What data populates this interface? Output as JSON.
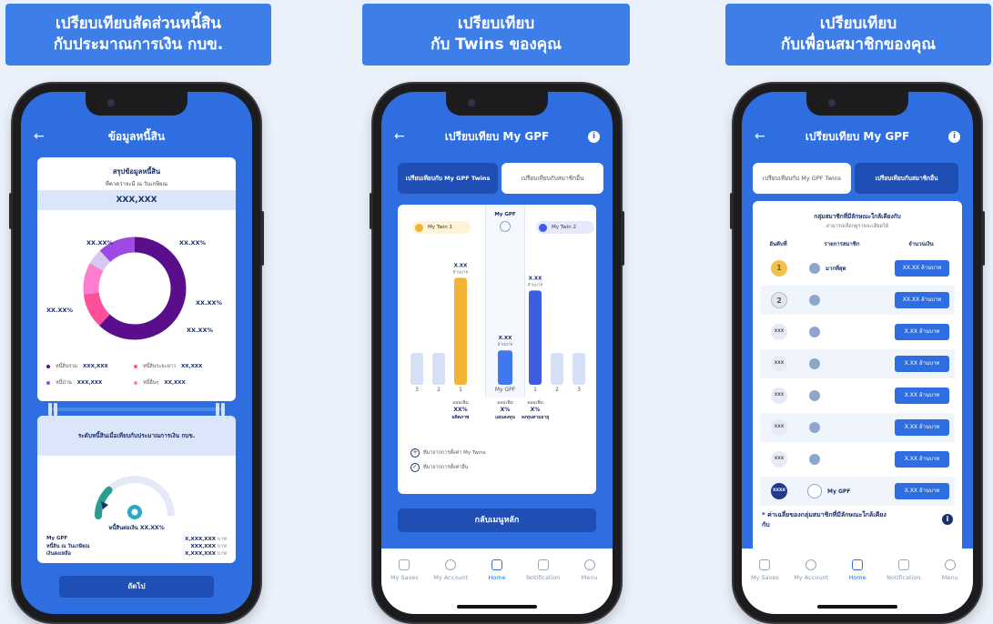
{
  "headers": [
    {
      "line1": "เปรียบเทียบสัดส่วนหนี้สิน",
      "line2": "กับประมาณการเงิน กบข."
    },
    {
      "line1": "เปรียบเทียบ",
      "line2": "กับ Twins ของคุณ"
    },
    {
      "line1": "เปรียบเทียบ",
      "line2": "กับเพื่อนสมาชิกของคุณ"
    }
  ],
  "colors": {
    "primary": "#2f6ee0",
    "header": "#3d7ee8",
    "dark_purple": "#5a0e8c",
    "pink": "#ff4f9a",
    "light_pink": "#ff7dd0",
    "purple": "#a04ae6",
    "orange": "#f5b335",
    "blue_bar": "#3f5de0"
  },
  "phone1": {
    "title": "ข้อมูลหนี้สิน",
    "summary_title": "สรุปข้อมูลหนี้สิน",
    "summary_sub": "ที่คาดว่าจะมี ณ วันเกษียณ",
    "total": "XXX,XXX",
    "donut_labels": [
      "XX.XX%",
      "XX.XX%",
      "XX.XX%",
      "XX.XX%",
      "XX.XX%"
    ],
    "donut_shares": [
      62,
      11,
      10,
      5,
      12
    ],
    "legend": [
      {
        "name": "หนี้สินรวม",
        "value": "XXX,XXX"
      },
      {
        "name": "หนี้สินระยะยาว",
        "value": "XX,XXX"
      },
      {
        "name": "หนี้บ้าน",
        "value": "XXX,XXX"
      },
      {
        "name": "หนี้อื่นๆ",
        "value": "XX,XXX"
      }
    ],
    "compare_title": "ระดับหนี้สินเมื่อเทียบกับประมาณการเงิน กบข.",
    "gauge_caption": "หนี้สินต่อเงิน XX.XX%",
    "gauge_level": 0.62,
    "rows": [
      {
        "label": "My GPF",
        "value": "X,XXX,XXX",
        "unit": "บาท"
      },
      {
        "label": "หนี้สิน ณ วันเกษียณ",
        "value": "XXX,XXX",
        "unit": "บาท"
      },
      {
        "label": "เงินคงเหลือ",
        "value": "X,XXX,XXX",
        "unit": "บาท"
      }
    ],
    "next_button": "ถัดไป"
  },
  "phone2": {
    "title": "เปรียบเทียบ My GPF",
    "tab_active": "เปรียบเทียบกับ My GPF Twins",
    "tab_inactive": "เปรียบเทียบกับสมาชิกอื่น",
    "me_label": "My GPF",
    "twin1": "My Twin 1",
    "twin2": "My Twin 2",
    "bar_values": [
      {
        "name": "1",
        "value": "X.XX",
        "unit": "ล้านบาท",
        "height": 0.84
      },
      {
        "name": "My GPF",
        "value": "X.XX",
        "unit": "ล้านบาท",
        "height": 0.27
      },
      {
        "name": "1",
        "value": "X.XX",
        "unit": "ล้านบาท",
        "height": 0.74
      }
    ],
    "x_labels": [
      "3",
      "2",
      "1",
      "My GPF",
      "1",
      "2",
      "3"
    ],
    "stats": [
      {
        "label": "ออมเพิ่ม",
        "value": "XX%",
        "sub": "ผลิตภาพ"
      },
      {
        "label": "ออมเพิ่ม",
        "value": "X%",
        "sub": "แผนลงทุน"
      },
      {
        "label": "ออมเพิ่ม",
        "value": "X%",
        "sub": "ลงทุนตามอายุ"
      }
    ],
    "legend1": "ที่มาจากการตั้งค่า My Twins",
    "legend2": "ที่มาจากการตั้งค่าอื่น",
    "back_button": "กลับเมนูหลัก"
  },
  "phone3": {
    "title": "เปรียบเทียบ My GPF",
    "tab_inactive": "เปรียบเทียบกับ My GPF Twins",
    "tab_active": "เปรียบเทียบกับสมาชิกอื่น",
    "group_title": "กลุ่มสมาชิกที่มีลักษณะใกล้เคียงกับ",
    "group_sub": "สามารถเลือกดูรายละเอียดได้",
    "col_rank": "อันดับที่",
    "col_member": "รายการสมาชิก",
    "col_amount": "จำนวนเงิน",
    "ranks": [
      {
        "rank": "1",
        "member": "มากที่สุด",
        "amount": "XX.XX ล้านบาท"
      },
      {
        "rank": "2",
        "member": "",
        "amount": "XX.XX ล้านบาท"
      },
      {
        "rank": "XXX",
        "member": "",
        "amount": "X.XX ล้านบาท"
      },
      {
        "rank": "XXX",
        "member": "",
        "amount": "X.XX ล้านบาท"
      },
      {
        "rank": "XXX",
        "member": "",
        "amount": "X.XX ล้านบาท"
      },
      {
        "rank": "XXX",
        "member": "",
        "amount": "X.XX ล้านบาท"
      },
      {
        "rank": "XXX",
        "member": "",
        "amount": "X.XX ล้านบาท"
      },
      {
        "rank": "XXXX",
        "member": "My GPF",
        "amount": "X.XX ล้านบาท"
      }
    ],
    "footnote": "* ค่าเฉลี่ยของกลุ่มสมาชิกที่มีลักษณะใกล้เคียงกับ"
  },
  "nav": [
    "My Saves",
    "My Account",
    "Home",
    "Notification",
    "Menu"
  ]
}
